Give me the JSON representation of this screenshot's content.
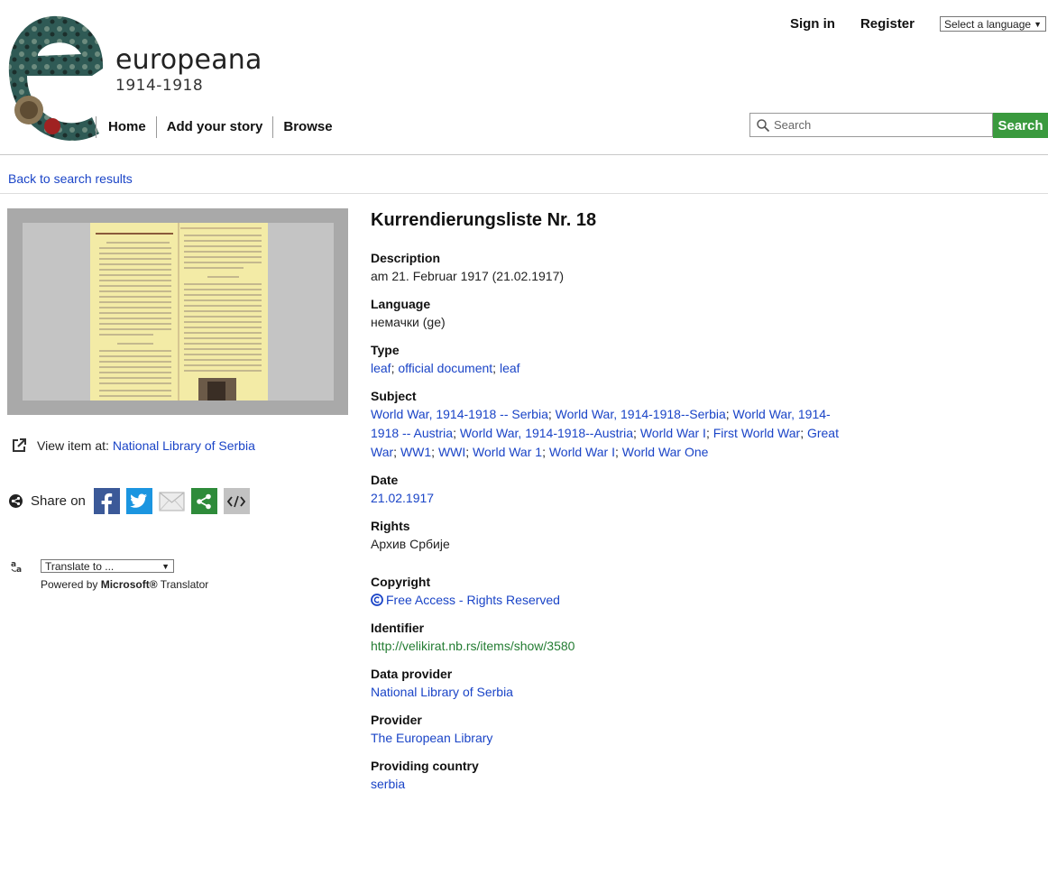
{
  "header": {
    "logo_title": "europeana",
    "logo_subtitle": "1914-1918",
    "nav": [
      "Home",
      "Add your story",
      "Browse"
    ],
    "sign_in": "Sign in",
    "register": "Register",
    "language_select": "Select a language",
    "search_placeholder": "Search",
    "search_button": "Search"
  },
  "back_link": "Back to search results",
  "sidebar": {
    "view_item_label": "View item at:",
    "view_item_link": "National Library of Serbia",
    "share_label": "Share on",
    "translate_select": "Translate to ...",
    "powered_prefix": "Powered by",
    "powered_brand": "Microsoft®",
    "powered_suffix": "Translator"
  },
  "item": {
    "title": "Kurrendierungsliste Nr. 18",
    "description_label": "Description",
    "description": "am 21. Februar 1917 (21.02.1917)",
    "language_label": "Language",
    "language": "немачки (ge)",
    "type_label": "Type",
    "types": [
      "leaf",
      "official document",
      "leaf"
    ],
    "subject_label": "Subject",
    "subjects": [
      "World War, 1914-1918 -- Serbia",
      "World War, 1914-1918--Serbia",
      "World War, 1914-1918 -- Austria",
      "World War, 1914-1918--Austria",
      "World War I",
      "First World War",
      "Great War",
      "WW1",
      "WWI",
      "World War 1",
      "World War I",
      "World War One"
    ],
    "date_label": "Date",
    "date": "21.02.1917",
    "rights_label": "Rights",
    "rights": "Архив Србије",
    "copyright_label": "Copyright",
    "copyright": "Free Access - Rights Reserved",
    "identifier_label": "Identifier",
    "identifier": "http://velikirat.nb.rs/items/show/3580",
    "data_provider_label": "Data provider",
    "data_provider": "National Library of Serbia",
    "provider_label": "Provider",
    "provider": "The European Library",
    "providing_country_label": "Providing country",
    "providing_country": "serbia"
  },
  "colors": {
    "link": "#1a44c7",
    "search_button": "#3a9a3e",
    "identifier": "#237c32",
    "facebook": "#3b5998",
    "twitter": "#1b95e0",
    "share_green": "#2e8b3a"
  },
  "icons": [
    "europeana-logo",
    "search-icon",
    "external-link-icon",
    "share-icon",
    "facebook-icon",
    "twitter-icon",
    "email-icon",
    "share-green-icon",
    "embed-code-icon",
    "translate-icon",
    "copyright-icon"
  ]
}
